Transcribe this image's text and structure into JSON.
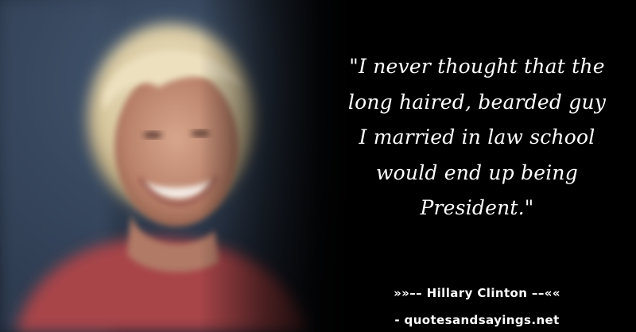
{
  "quote": {
    "text": "\"I never thought that the\nlong haired, bearded guy\nI married in law school\nwould end up being\nPresident.\""
  },
  "attribution": {
    "author_line": "»»–– Hillary Clinton ––««"
  },
  "footer": {
    "source": "- quotesandsayings.net"
  },
  "colors": {
    "background": "#000000",
    "text": "#ffffff"
  }
}
